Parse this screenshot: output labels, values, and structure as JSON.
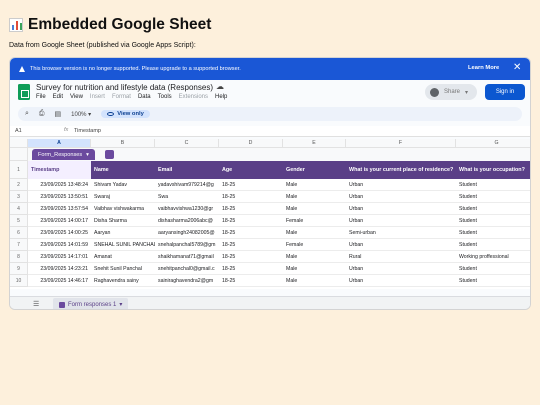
{
  "page": {
    "title": "Embedded Google Sheet",
    "subtitle": "Data from Google Sheet (published via Google Apps Script):"
  },
  "banner": {
    "message": "This browser version is no longer supported. Please upgrade to a supported browser.",
    "learn_more": "Learn More",
    "close": "✕"
  },
  "sheet": {
    "doc_title": "Survey for nutrition and lifestyle data (Responses)",
    "menus": [
      {
        "label": "File",
        "enabled": true
      },
      {
        "label": "Edit",
        "enabled": true
      },
      {
        "label": "View",
        "enabled": true
      },
      {
        "label": "Insert",
        "enabled": false
      },
      {
        "label": "Format",
        "enabled": false
      },
      {
        "label": "Data",
        "enabled": true
      },
      {
        "label": "Tools",
        "enabled": true
      },
      {
        "label": "Extensions",
        "enabled": false
      },
      {
        "label": "Help",
        "enabled": true
      }
    ],
    "share_label": "Share",
    "signin_label": "Sign in",
    "zoom": "100%",
    "view_only": "View only",
    "cell_ref": "A1",
    "fx_symbol": "fx",
    "formula_value": "Timestamp",
    "column_letters": [
      "A",
      "B",
      "C",
      "D",
      "E",
      "F",
      "G"
    ],
    "table_name": "Form_Responses",
    "headers": [
      "Timestamp",
      "Name",
      "Email",
      "Age",
      "Gender",
      "What is your current place of residence?",
      "What is your occupation?"
    ],
    "rows": [
      [
        "23/09/2025 13:48:24",
        "Shivam Yadav",
        "yadavshivam979214@g",
        "18-25",
        "Male",
        "Urban",
        "Student"
      ],
      [
        "23/09/2025 13:50:51",
        "Swaraj",
        "Swa",
        "18-25",
        "Male",
        "Urban",
        "Student"
      ],
      [
        "23/09/2025 13:57:54",
        "Vaibhav vishwakarma",
        "vaibhavvishwa1230@gr",
        "18-25",
        "Male",
        "Urban",
        "Student"
      ],
      [
        "23/09/2025 14:00:17",
        "Disha Sharma",
        "dishasharma2006abc@",
        "18-25",
        "Female",
        "Urban",
        "Student"
      ],
      [
        "23/09/2025 14:00:25",
        "Aaryan",
        "aaryansingh24082005@",
        "18-25",
        "Male",
        "Semi-urban",
        "Student"
      ],
      [
        "23/09/2025 14:01:59",
        "SNEHAL SUNIL PANCHAL",
        "snehalpanchal5789@gm",
        "18-25",
        "Female",
        "Urban",
        "Student"
      ],
      [
        "23/09/2025 14:17:01",
        "Amanat",
        "shaikhamanat71@gmail",
        "18-25",
        "Male",
        "Rural",
        "Working proffessional"
      ],
      [
        "23/09/2025 14:23:21",
        "Snehit Sunil Panchal",
        "snehitpanchal0@gmail.c",
        "18-25",
        "Male",
        "Urban",
        "Student"
      ],
      [
        "23/09/2025 14:46:17",
        "Raghavendra sainy",
        "sainiraghavendra2@gm",
        "18-25",
        "Male",
        "Urban",
        "Student"
      ]
    ],
    "row_numbers": [
      "1",
      "2",
      "3",
      "4",
      "5",
      "6",
      "7",
      "8",
      "9",
      "10"
    ],
    "sheet_tab": "Form responses 1"
  }
}
